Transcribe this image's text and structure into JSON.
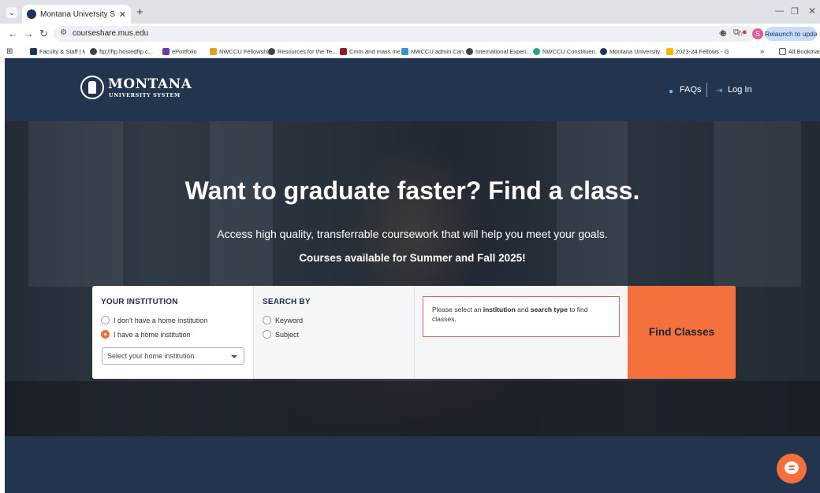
{
  "browser": {
    "tab_title": "Montana University System - F",
    "url": "courseshare.mus.edu",
    "relaunch_label": "Relaunch to update",
    "profile_initial": "S",
    "bookmarks": [
      "Faculty & Staff | MS...",
      "ftp://ftp.hostedftp.c...",
      "ePortfolio",
      "NWCCU Fellowships...",
      "Resources for the Te...",
      "Cmm and mass me...",
      "NWCCU admin Can...",
      "International Experi...",
      "NWCCU Constituen...",
      "Montana University...",
      "2023-24 Fellows - G..."
    ],
    "all_bookmarks_label": "All Bookmarks"
  },
  "header": {
    "logo_word": "MONTANA",
    "logo_sub": "UNIVERSITY SYSTEM",
    "faqs": "FAQs",
    "login": "Log In"
  },
  "hero": {
    "title": "Want to graduate faster? Find a class.",
    "subtitle": "Access high quality, transferrable coursework that will help you meet your goals.",
    "note": "Courses available for Summer and Fall 2025!"
  },
  "search": {
    "institution_heading": "YOUR INSTITUTION",
    "no_home_label": "I don't have a home institution",
    "home_label": "I have a home institution",
    "select_placeholder": "Select your home institution",
    "search_by_heading": "SEARCH BY",
    "keyword_label": "Keyword",
    "subject_label": "Subject",
    "message_prefix": "Please select an ",
    "message_institution": "institution",
    "message_and": " and ",
    "message_search_type": "search type",
    "message_suffix": " to find classes.",
    "find_button": "Find Classes"
  },
  "colors": {
    "header_bg": "#23344f",
    "accent_orange": "#f4703c",
    "error_border": "#d06a63"
  }
}
